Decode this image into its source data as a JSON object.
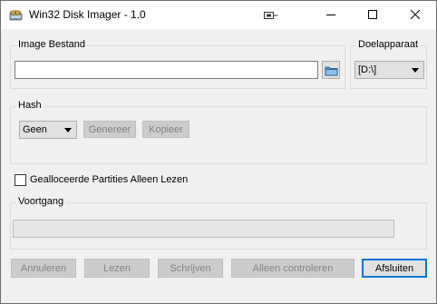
{
  "window": {
    "title": "Win32 Disk Imager - 1.0"
  },
  "image_file": {
    "group_label": "Image Bestand",
    "path_value": ""
  },
  "target_device": {
    "group_label": "Doelapparaat",
    "selected": "[D:\\]"
  },
  "hash": {
    "group_label": "Hash",
    "selected": "Geen",
    "generate_label": "Genereer",
    "copy_label": "Kopieer"
  },
  "read_only_allocated": {
    "label": "Gealloceerde Partities Alleen Lezen",
    "checked": false
  },
  "progress": {
    "group_label": "Voortgang",
    "value": 0
  },
  "buttons": {
    "cancel": "Annuleren",
    "read": "Lezen",
    "write": "Schrijven",
    "verify_only": "Alleen controleren",
    "exit": "Afsluiten"
  },
  "colors": {
    "accent": "#0078d7",
    "window_bg": "#f0f0f0",
    "disabled_button_bg": "#cccccc",
    "disabled_text": "#838383"
  }
}
